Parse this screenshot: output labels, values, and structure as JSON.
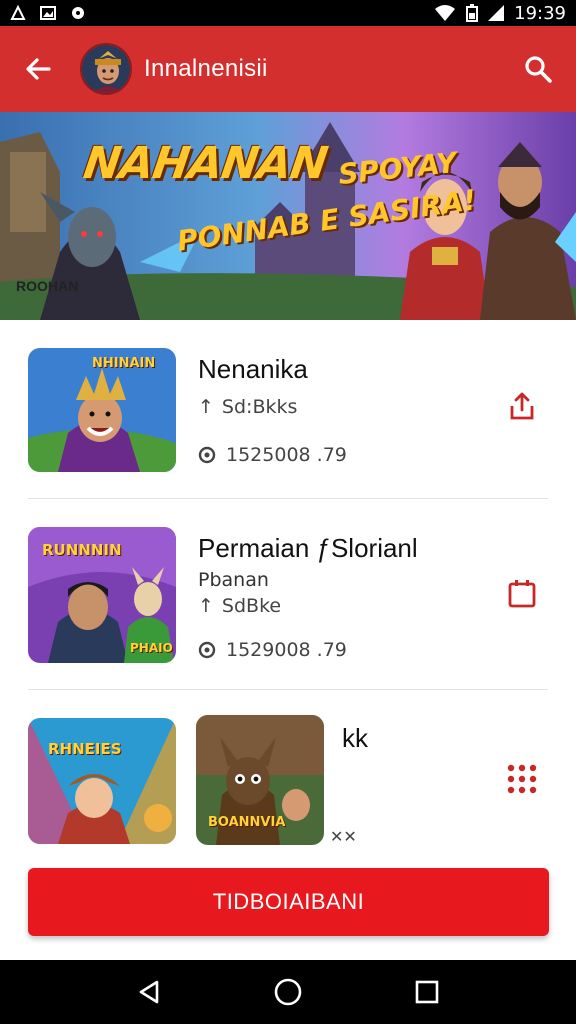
{
  "status_bar": {
    "time": "19:39"
  },
  "app_bar": {
    "title": "Innalnenisii"
  },
  "banner": {
    "headline": "NAHANAN",
    "subline_1": "SPOYAY",
    "subline_2": "PONNAB E SASIRA!",
    "logo_text": "ROOHAN"
  },
  "list": [
    {
      "title": "Nenanika",
      "subtitle": "",
      "tag": "Sd:Bkks",
      "stats": "1525008 .79"
    },
    {
      "title": "Permaian ƒSlorianl",
      "subtitle": "Pbanan",
      "tag": "SdBke",
      "stats": "1529008 .79"
    },
    {
      "title": "kk",
      "subtitle": "",
      "tag": "",
      "stats": ""
    }
  ],
  "thumbs": {
    "item1": "NHINAIN",
    "item2a": "RUNNNIN",
    "item2b": "PHAIO",
    "item3a": "RHNEIES",
    "item3b": "BOANNVIA"
  },
  "cta": {
    "label": "TIDBOIAIBANI"
  },
  "colors": {
    "primary": "#d32f2f",
    "cta": "#e8191e",
    "accent_icon": "#c62828"
  }
}
